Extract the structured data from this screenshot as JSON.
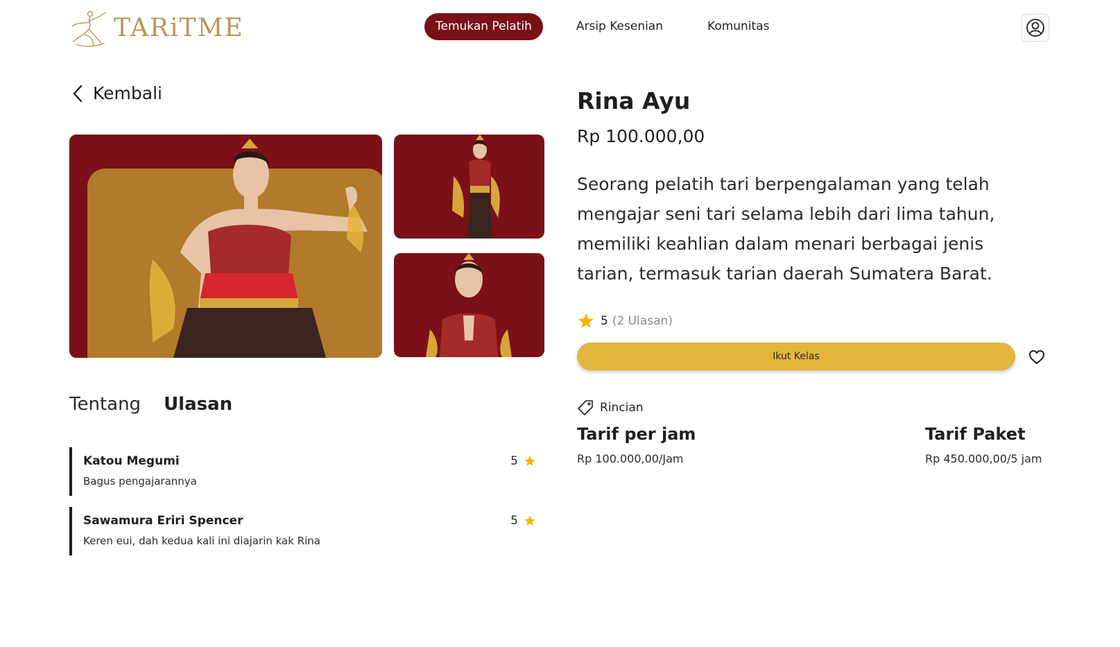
{
  "header": {
    "brand": "TARiTME",
    "nav": [
      {
        "label": "Temukan Pelatih",
        "active": true
      },
      {
        "label": "Arsip Kesenian",
        "active": false
      },
      {
        "label": "Komunitas",
        "active": false
      }
    ],
    "profile_icon": "user-circle-icon"
  },
  "back": {
    "label": "Kembali",
    "icon": "chevron-left-icon"
  },
  "gallery": {
    "main_alt": "dancer-photo",
    "background_color": "#7a1018",
    "panel_color": "#b27a2b"
  },
  "tabs": [
    {
      "label": "Tentang",
      "active": false
    },
    {
      "label": "Ulasan",
      "active": true
    }
  ],
  "reviews": [
    {
      "name": "Katou Megumi",
      "text": "Bagus pengajarannya",
      "rating": "5"
    },
    {
      "name": "Sawamura Eriri Spencer",
      "text": "Keren eui, dah kedua kali ini diajarin kak Rina",
      "rating": "5"
    }
  ],
  "trainer": {
    "name": "Rina Ayu",
    "price": "Rp 100.000,00",
    "description": "Seorang pelatih tari berpengalaman yang telah mengajar seni tari selama lebih dari lima tahun, memiliki keahlian dalam menari berbagai jenis tarian, termasuk tarian daerah Sumatera Barat.",
    "rating": "5",
    "review_count": "(2 Ulasan)"
  },
  "actions": {
    "join_label": "Ikut Kelas",
    "favorite_icon": "heart-icon"
  },
  "details": {
    "heading": "Rincian",
    "heading_icon": "tag-icon",
    "hourly_title": "Tarif per jam",
    "hourly_value": "Rp 100.000,00/Jam",
    "package_title": "Tarif Paket",
    "package_value": "Rp 450.000,00/5 jam"
  },
  "colors": {
    "brand": "#7a1018",
    "accent": "#e3b53c",
    "star": "#f2b705",
    "logo": "#b8955a"
  }
}
